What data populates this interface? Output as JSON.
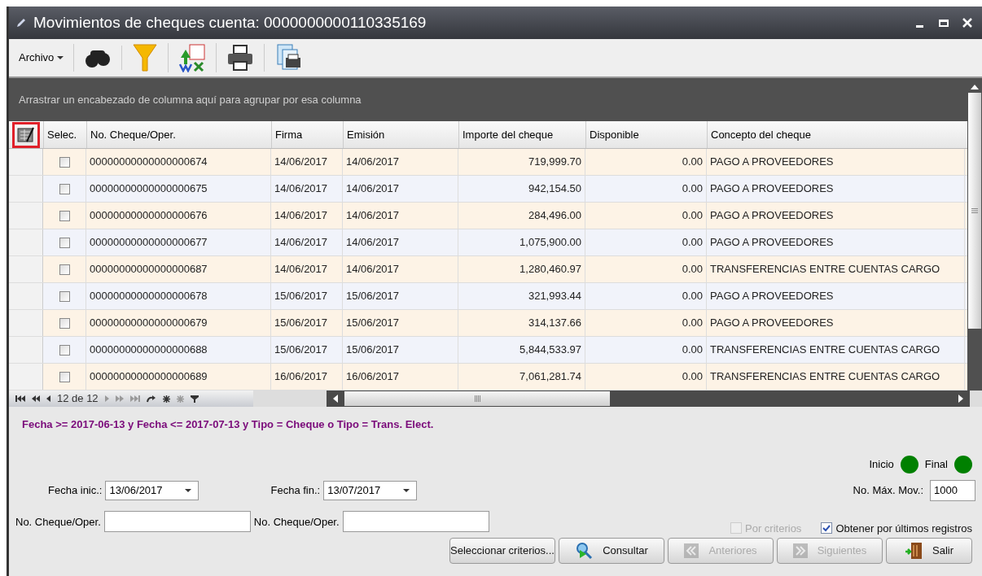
{
  "window": {
    "title": "Movimientos de cheques cuenta: 0000000000110335169"
  },
  "toolbar": {
    "menu": "Archivo"
  },
  "group_hint": "Arrastrar un encabezado de columna aquí para agrupar por esa columna",
  "table": {
    "select_column": "Selec.",
    "columns": [
      "No. Cheque/Oper.",
      "Firma",
      "Emisión",
      "Importe del cheque",
      "Disponible",
      "Concepto del cheque"
    ],
    "rows": [
      {
        "checked": false,
        "cells": [
          "00000000000000000674",
          "14/06/2017",
          "14/06/2017",
          "719,999.70",
          "0.00",
          "PAGO A PROVEEDORES"
        ]
      },
      {
        "checked": false,
        "cells": [
          "00000000000000000675",
          "14/06/2017",
          "14/06/2017",
          "942,154.50",
          "0.00",
          "PAGO A PROVEEDORES"
        ]
      },
      {
        "checked": false,
        "cells": [
          "00000000000000000676",
          "14/06/2017",
          "14/06/2017",
          "284,496.00",
          "0.00",
          "PAGO A PROVEEDORES"
        ]
      },
      {
        "checked": false,
        "cells": [
          "00000000000000000677",
          "14/06/2017",
          "14/06/2017",
          "1,075,900.00",
          "0.00",
          "PAGO A PROVEEDORES"
        ]
      },
      {
        "checked": false,
        "cells": [
          "00000000000000000687",
          "14/06/2017",
          "14/06/2017",
          "1,280,460.97",
          "0.00",
          "TRANSFERENCIAS ENTRE CUENTAS CARGO"
        ]
      },
      {
        "checked": false,
        "cells": [
          "00000000000000000678",
          "15/06/2017",
          "15/06/2017",
          "321,993.44",
          "0.00",
          "PAGO A PROVEEDORES"
        ]
      },
      {
        "checked": false,
        "cells": [
          "00000000000000000679",
          "15/06/2017",
          "15/06/2017",
          "314,137.66",
          "0.00",
          "PAGO A PROVEEDORES"
        ]
      },
      {
        "checked": false,
        "cells": [
          "00000000000000000688",
          "15/06/2017",
          "15/06/2017",
          "5,844,533.97",
          "0.00",
          "TRANSFERENCIAS ENTRE CUENTAS CARGO"
        ]
      },
      {
        "checked": false,
        "cells": [
          "00000000000000000689",
          "16/06/2017",
          "16/06/2017",
          "7,061,281.74",
          "0.00",
          "TRANSFERENCIAS ENTRE CUENTAS CARGO"
        ]
      }
    ]
  },
  "navigator": {
    "position": "12 de 12"
  },
  "filter_text": "Fecha >= 2017-06-13  y Fecha <= 2017-07-13 y Tipo = Cheque o  Tipo = Trans. Elect.",
  "indicators": [
    {
      "label": "Inicio",
      "color": "#008000"
    },
    {
      "label": "Final",
      "color": "#008000"
    }
  ],
  "form": {
    "fecha_inic": {
      "label": "Fecha inic.:",
      "value": "13/06/2017"
    },
    "fecha_fin": {
      "label": "Fecha fin.:",
      "value": "13/07/2017"
    },
    "max_mov": {
      "label": "No. Máx. Mov.:",
      "value": "1000"
    },
    "cheque_from": {
      "label": "No. Cheque/Oper."
    },
    "cheque_to": {
      "label": "No. Cheque/Oper."
    },
    "por_criterios": {
      "label": "Por criterios",
      "checked": false,
      "disabled": true
    },
    "ultimos": {
      "label": "Obtener por últimos registros",
      "checked": true,
      "disabled": false
    }
  },
  "buttons": [
    {
      "label": "Seleccionar criterios...",
      "kind": "plain",
      "disabled": false
    },
    {
      "label": "Consultar",
      "kind": "search",
      "disabled": false
    },
    {
      "label": "Anteriores",
      "kind": "prev",
      "disabled": true
    },
    {
      "label": "Siguientes",
      "kind": "next",
      "disabled": true
    },
    {
      "label": "Salir",
      "kind": "exit",
      "disabled": false
    }
  ]
}
